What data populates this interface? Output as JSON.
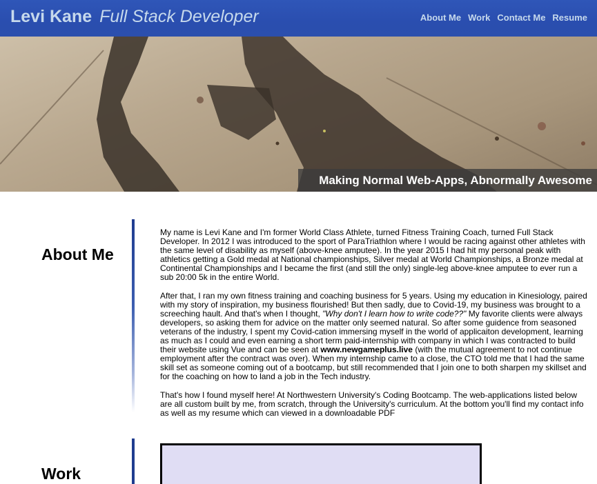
{
  "header": {
    "name": "Levi Kane",
    "role": "Full Stack Developer",
    "nav": [
      "About Me",
      "Work",
      "Contact Me",
      "Resume"
    ]
  },
  "hero": {
    "tagline": "Making Normal Web-Apps, Abnormally Awesome"
  },
  "about": {
    "title": "About Me",
    "p1": "My name is Levi Kane and I'm former World Class Athlete, turned Fitness Training Coach, turned Full Stack Developer. In 2012 I was introduced to the sport of ParaTriathlon where I would be racing against other athletes with the same level of disability as myself (above-knee amputee). In the year 2015 I had hit my personal peak with athletics getting a Gold medal at National championships, Silver medal at World Championships, a Bronze medal at Continental Championships and I became the first (and still the only) single-leg above-knee amputee to ever run a sub 20:00 5k in the entire World.",
    "p2_a": "After that, I ran my own fitness training and coaching business for 5 years. Using my education in Kinesiology, paired with my story of inspiration, my business flourished! But then sadly, due to Covid-19, my business was brought to a screeching hault. And that's when I thought, ",
    "p2_quote": "\"Why don't I learn how to write code??\"",
    "p2_b": " My favorite clients were always developers, so asking them for advice on the matter only seemed natural. So after some guidence from seasoned veterans of the industry, I spent my Covid-cation immersing myself in the world of applicaiton development, learning as much as I could and even earning a short term paid-internship with company in which I was contracted to build their website using Vue and can be seen at ",
    "p2_link": "www.newgameplus.live",
    "p2_c": " (with the mutual agreement to not continue employment after the contract was over). When my internship came to a close, the CTO told me that I had the same skill set as someone coming out of a bootcamp, but still recommended that I join one to both sharpen my skillset and for the coaching on how to land a job in the Tech industry.",
    "p3": "That's how I found myself here! At Northwestern University's Coding Bootcamp. The web-applications listed below are all custom built by me, from scratch, through the University's curriculum. At the bottom you'll find my contact info as well as my resume which can viewed in a downloadable PDF"
  },
  "work": {
    "title": "Work"
  }
}
